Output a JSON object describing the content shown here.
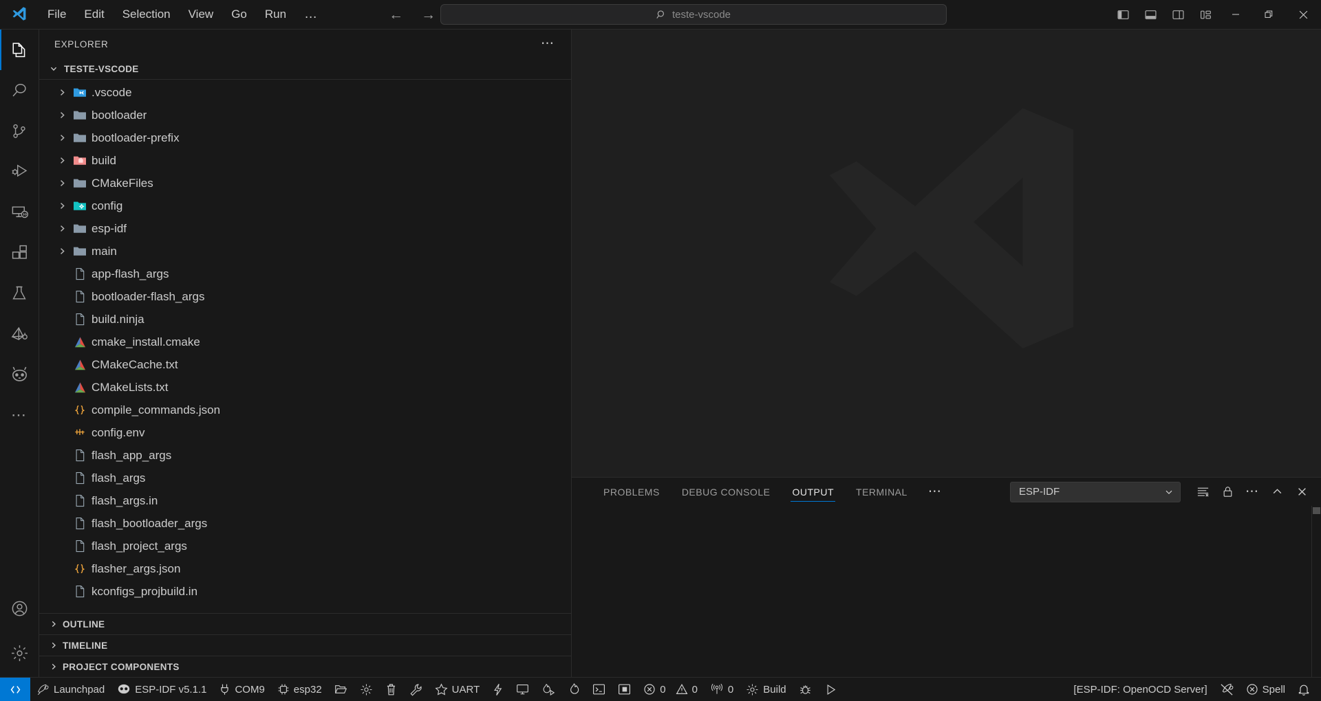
{
  "titlebar": {
    "logo_icon": "vscode-logo-icon",
    "menu": [
      {
        "label": "File"
      },
      {
        "label": "Edit"
      },
      {
        "label": "Selection"
      },
      {
        "label": "View"
      },
      {
        "label": "Go"
      },
      {
        "label": "Run"
      }
    ],
    "menu_overflow": "…",
    "nav_back_icon": "arrow-left-icon",
    "nav_forward_icon": "arrow-right-icon",
    "search": {
      "icon": "search-icon",
      "value": "teste-vscode"
    },
    "layout_buttons": [
      {
        "name": "toggle-primary-sidebar",
        "title": "Toggle Primary Side Bar"
      },
      {
        "name": "toggle-panel",
        "title": "Toggle Panel"
      },
      {
        "name": "toggle-secondary-sidebar",
        "title": "Toggle Secondary Side Bar"
      },
      {
        "name": "customize-layout",
        "title": "Customize Layout"
      }
    ],
    "window_buttons": [
      {
        "name": "minimize",
        "glyph": "—"
      },
      {
        "name": "restore",
        "glyph": "❐"
      },
      {
        "name": "close",
        "glyph": "✕"
      }
    ]
  },
  "activitybar": {
    "items": [
      {
        "name": "explorer",
        "label": "Explorer",
        "icon": "files-icon",
        "active": true
      },
      {
        "name": "search",
        "label": "Search",
        "icon": "search-icon",
        "active": false
      },
      {
        "name": "source-control",
        "label": "Source Control",
        "icon": "source-control-icon",
        "active": false
      },
      {
        "name": "run-and-debug",
        "label": "Run and Debug",
        "icon": "debug-alt-icon",
        "active": false
      },
      {
        "name": "remote-explorer",
        "label": "Remote Explorer",
        "icon": "remote-icon",
        "active": false
      },
      {
        "name": "extensions",
        "label": "Extensions",
        "icon": "extensions-icon",
        "active": false
      },
      {
        "name": "testing",
        "label": "Testing",
        "icon": "beaker-icon",
        "active": false
      },
      {
        "name": "esp-idf-explorer",
        "label": "ESP-IDF Explorer",
        "icon": "espressif-icon",
        "active": false
      },
      {
        "name": "platformio",
        "label": "PlatformIO",
        "icon": "platformio-alien-icon",
        "active": false
      },
      {
        "name": "additional-views",
        "label": "Additional Views",
        "icon": "ellipsis-icon",
        "active": false
      }
    ],
    "bottom_items": [
      {
        "name": "accounts",
        "label": "Accounts",
        "icon": "account-icon"
      },
      {
        "name": "manage",
        "label": "Manage",
        "icon": "gear-icon"
      }
    ]
  },
  "sidebar": {
    "title": "EXPLORER",
    "more_actions_icon": "ellipsis-icon",
    "root": {
      "label": "TESTE-VSCODE",
      "expanded": true,
      "twisty": "⌄"
    },
    "files": [
      {
        "name": ".vscode",
        "type": "folder",
        "icon": "folder-vscode-icon",
        "expandable": true
      },
      {
        "name": "bootloader",
        "type": "folder",
        "icon": "folder-icon",
        "expandable": true
      },
      {
        "name": "bootloader-prefix",
        "type": "folder",
        "icon": "folder-icon",
        "expandable": true
      },
      {
        "name": "build",
        "type": "folder",
        "icon": "folder-build-icon",
        "expandable": true
      },
      {
        "name": "CMakeFiles",
        "type": "folder",
        "icon": "folder-icon",
        "expandable": true
      },
      {
        "name": "config",
        "type": "folder",
        "icon": "folder-config-icon",
        "expandable": true
      },
      {
        "name": "esp-idf",
        "type": "folder",
        "icon": "folder-icon",
        "expandable": true
      },
      {
        "name": "main",
        "type": "folder",
        "icon": "folder-icon",
        "expandable": true
      },
      {
        "name": "app-flash_args",
        "type": "file",
        "icon": "file-icon",
        "expandable": false
      },
      {
        "name": "bootloader-flash_args",
        "type": "file",
        "icon": "file-icon",
        "expandable": false
      },
      {
        "name": "build.ninja",
        "type": "file",
        "icon": "file-icon",
        "expandable": false
      },
      {
        "name": "cmake_install.cmake",
        "type": "file",
        "icon": "cmake-icon",
        "expandable": false
      },
      {
        "name": "CMakeCache.txt",
        "type": "file",
        "icon": "cmake-icon",
        "expandable": false
      },
      {
        "name": "CMakeLists.txt",
        "type": "file",
        "icon": "cmake-icon",
        "expandable": false
      },
      {
        "name": "compile_commands.json",
        "type": "file",
        "icon": "json-icon",
        "expandable": false
      },
      {
        "name": "config.env",
        "type": "file",
        "icon": "env-icon",
        "expandable": false
      },
      {
        "name": "flash_app_args",
        "type": "file",
        "icon": "file-icon",
        "expandable": false
      },
      {
        "name": "flash_args",
        "type": "file",
        "icon": "file-icon",
        "expandable": false
      },
      {
        "name": "flash_args.in",
        "type": "file",
        "icon": "file-icon",
        "expandable": false
      },
      {
        "name": "flash_bootloader_args",
        "type": "file",
        "icon": "file-icon",
        "expandable": false
      },
      {
        "name": "flash_project_args",
        "type": "file",
        "icon": "file-icon",
        "expandable": false
      },
      {
        "name": "flasher_args.json",
        "type": "file",
        "icon": "json-icon",
        "expandable": false
      },
      {
        "name": "kconfigs_projbuild.in",
        "type": "file",
        "icon": "file-icon",
        "expandable": false
      }
    ],
    "collapsed_sections": [
      {
        "label": "OUTLINE",
        "twisty": "›"
      },
      {
        "label": "TIMELINE",
        "twisty": "›"
      },
      {
        "label": "PROJECT COMPONENTS",
        "twisty": "›"
      }
    ]
  },
  "editor": {
    "watermark_icon": "vscode-watermark-logo"
  },
  "panel": {
    "tabs": [
      {
        "label": "PROBLEMS",
        "active": false
      },
      {
        "label": "DEBUG CONSOLE",
        "active": false
      },
      {
        "label": "OUTPUT",
        "active": true
      },
      {
        "label": "TERMINAL",
        "active": false
      }
    ],
    "overflow_icon": "ellipsis-icon",
    "channel": {
      "value": "ESP-IDF",
      "chevron_icon": "chevron-down-icon"
    },
    "actions": [
      {
        "name": "clear-output",
        "icon": "clear-all-icon"
      },
      {
        "name": "turn-auto-scrolling-off",
        "icon": "lock-icon"
      },
      {
        "name": "views-and-more-actions",
        "icon": "ellipsis-icon"
      },
      {
        "name": "maximize-panel-size",
        "icon": "chevron-up-icon"
      },
      {
        "name": "close-panel",
        "icon": "close-icon"
      }
    ],
    "content": ""
  },
  "statusbar": {
    "remote_icon": "remote-indicator-icon",
    "left_items": [
      {
        "name": "launchpad",
        "label": "Launchpad",
        "icon": "rocket-icon"
      },
      {
        "name": "esp-idf-version",
        "label": "ESP-IDF v5.1.1",
        "icon": "espressif-logo-icon"
      },
      {
        "name": "serial-port",
        "label": "COM9",
        "icon": "plug-icon"
      },
      {
        "name": "target-device",
        "label": "esp32",
        "icon": "chip-icon"
      },
      {
        "name": "open-project",
        "label": "",
        "icon": "folder-opened-icon"
      },
      {
        "name": "sdk-configuration-editor",
        "label": "",
        "icon": "gear-icon"
      },
      {
        "name": "full-clean",
        "label": "",
        "icon": "trash-icon"
      },
      {
        "name": "build-project",
        "label": "",
        "icon": "wrench-icon"
      },
      {
        "name": "select-flash-method",
        "label": "UART",
        "icon": "star-icon"
      },
      {
        "name": "flash-device",
        "label": "",
        "icon": "zap-icon"
      },
      {
        "name": "monitor-device",
        "label": "",
        "icon": "device-monitor-icon"
      },
      {
        "name": "build-flash-monitor",
        "label": "",
        "icon": "flame-play-icon"
      },
      {
        "name": "debug",
        "label": "",
        "icon": "debug-icon"
      },
      {
        "name": "esp-idf-terminal",
        "label": "",
        "icon": "terminal-icon"
      },
      {
        "name": "qemu-server",
        "label": "",
        "icon": "qemu-icon"
      },
      {
        "name": "problems-warnings",
        "label": "0",
        "icon": "error-icon",
        "second_label": "0",
        "second_icon": "warning-icon"
      },
      {
        "name": "radar-count",
        "label": "0",
        "icon": "broadcast-icon"
      },
      {
        "name": "build-task",
        "label": "Build",
        "icon": "gear-icon"
      },
      {
        "name": "debug-task",
        "label": "",
        "icon": "bug-icon"
      },
      {
        "name": "run-task",
        "label": "",
        "icon": "play-icon"
      }
    ],
    "right_items": [
      {
        "name": "openocd-server",
        "label": "[ESP-IDF: OpenOCD Server]",
        "icon": ""
      },
      {
        "name": "remote-server-disabled",
        "label": "",
        "icon": "server-disabled-icon"
      },
      {
        "name": "spell-checker",
        "label": "Spell",
        "icon": "error-circle-icon"
      },
      {
        "name": "notifications",
        "label": "",
        "icon": "bell-icon"
      }
    ]
  },
  "colors": {
    "accent": "#0078d4",
    "titlebar_bg": "#181818",
    "editor_bg": "#1f1f1f",
    "sidebar_bg": "#181818",
    "text": "#cccccc",
    "muted_text": "#9d9d9d",
    "folder": "#8a9aa9",
    "cmake_red": "#e44c3f",
    "cmake_blue": "#4a7ec4",
    "cmake_green": "#6aa84f",
    "json_orange": "#e9a13b",
    "build_pink": "#f08b8b",
    "config_teal": "#13c2c2",
    "vscode_blue": "#2f9ae0"
  }
}
